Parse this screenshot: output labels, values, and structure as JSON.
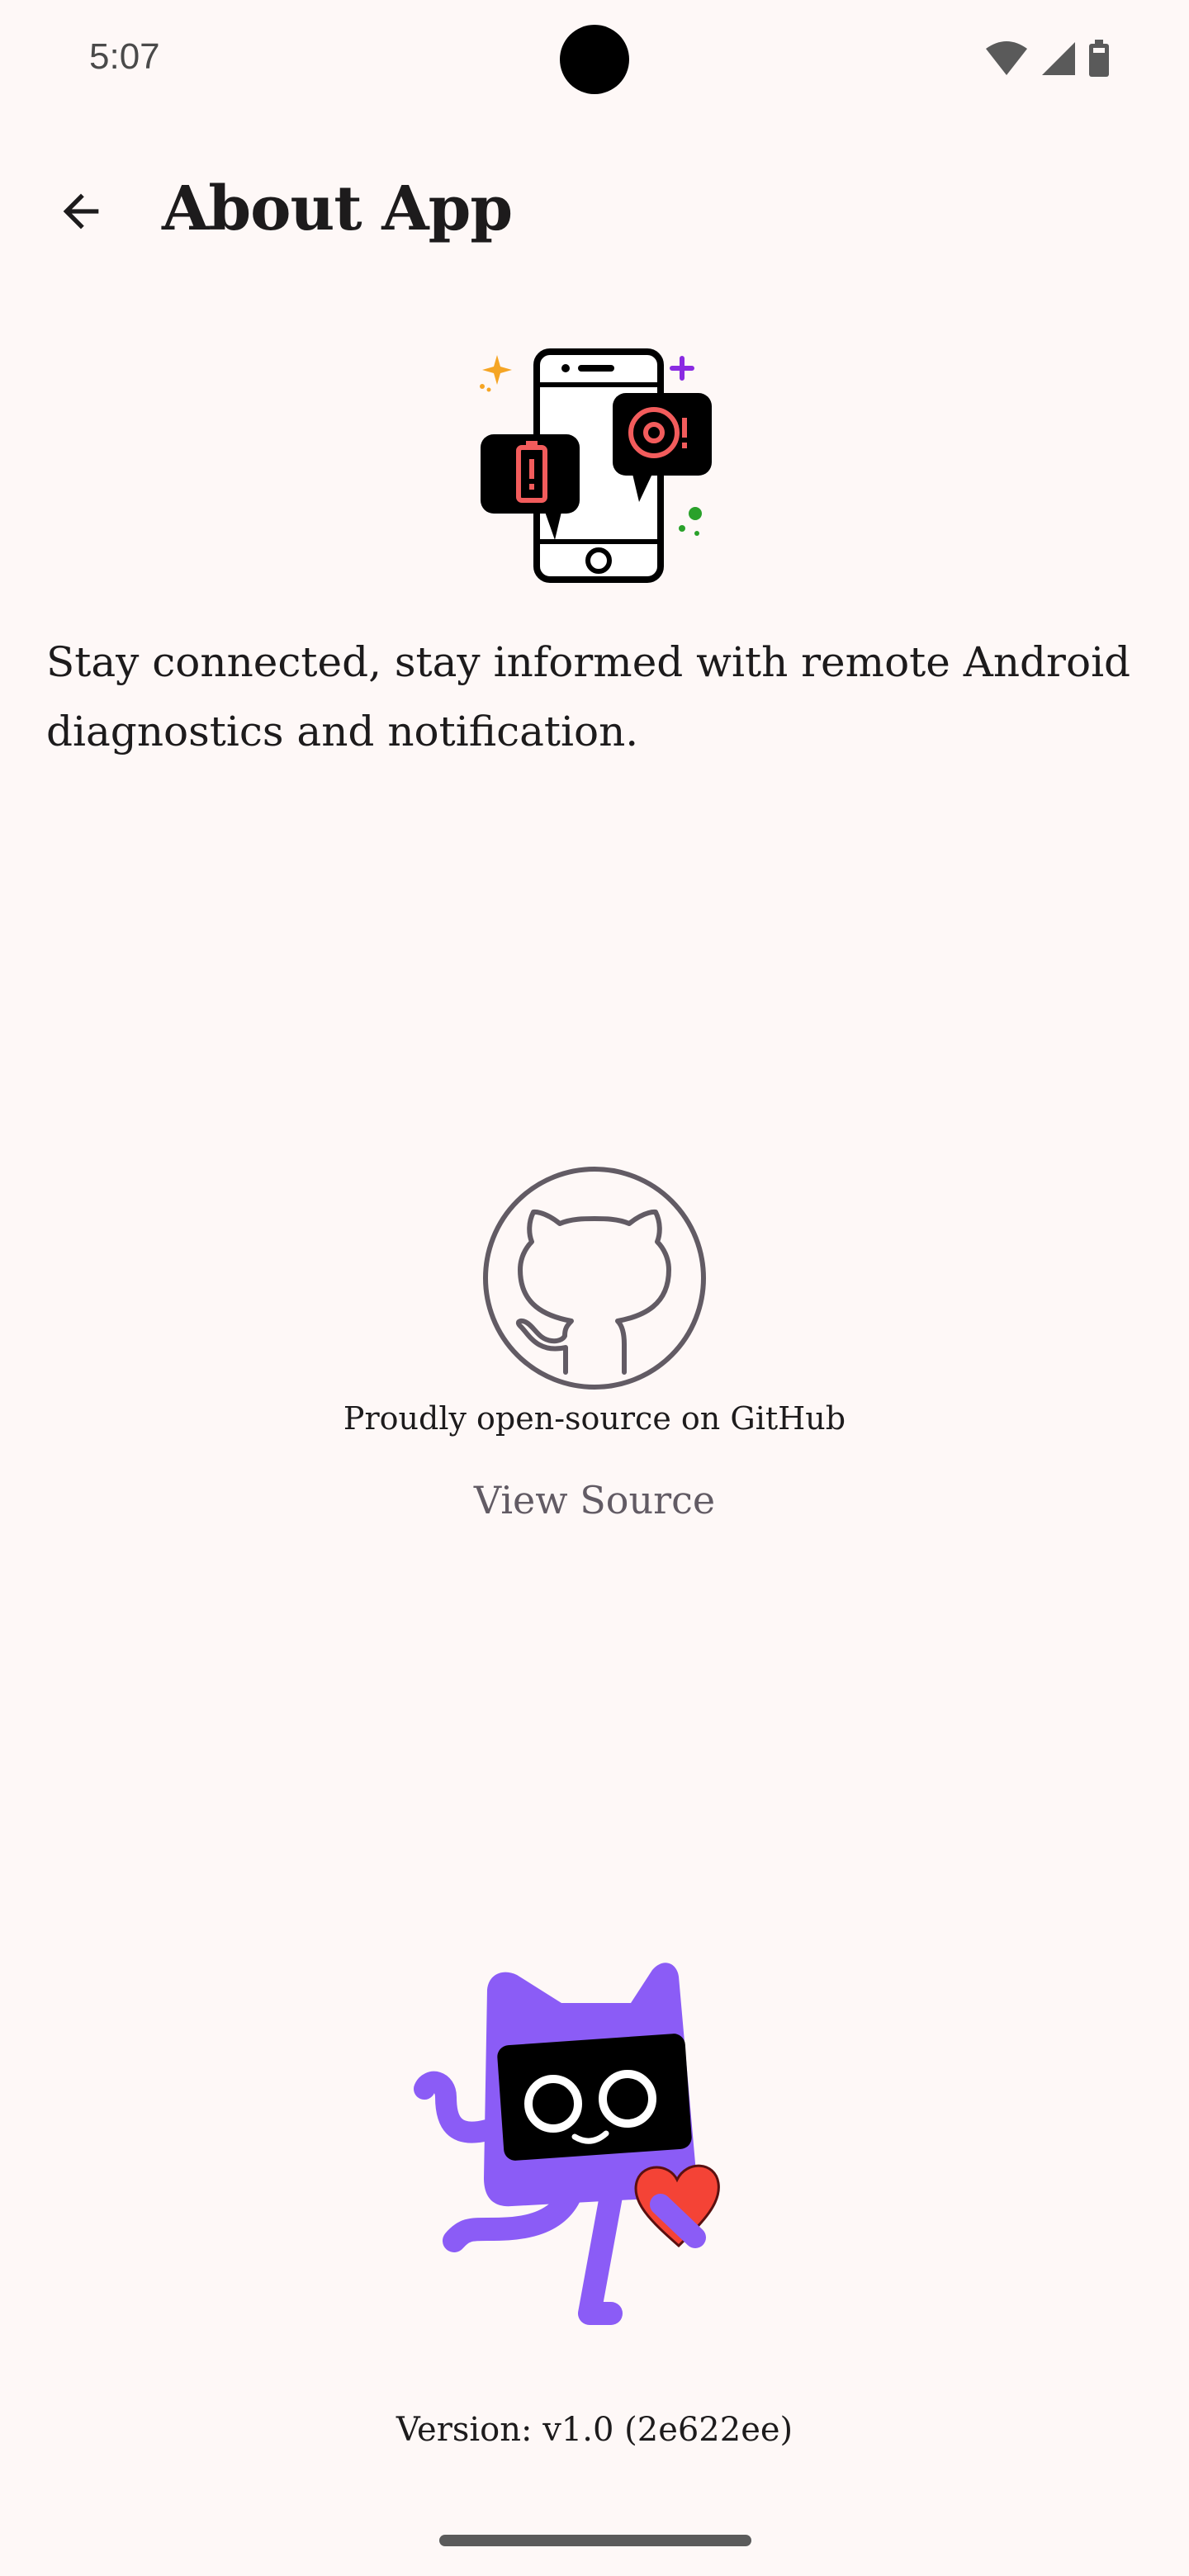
{
  "status_bar": {
    "time": "5:07",
    "icons": [
      "wifi-icon",
      "signal-icon",
      "battery-icon"
    ]
  },
  "top_bar": {
    "back_icon": "arrow-back-icon",
    "title": "About App"
  },
  "hero": {
    "icon": "phone-notification-illustration",
    "tagline": "Stay connected, stay informed with remote Android diagnostics and notification."
  },
  "github": {
    "icon": "github-icon",
    "caption": "Proudly open-source on GitHub",
    "view_source_label": "View Source"
  },
  "footer": {
    "mascot": "mascot-with-heart-illustration",
    "version": "Version: v1.0 (2e622ee)"
  },
  "colors": {
    "background": "#fef8f7",
    "text": "#1d1b1c",
    "muted": "#625b64",
    "accent_purple": "#8b5cf6",
    "heart_red": "#f44336",
    "notification_red": "#f25c5c"
  }
}
